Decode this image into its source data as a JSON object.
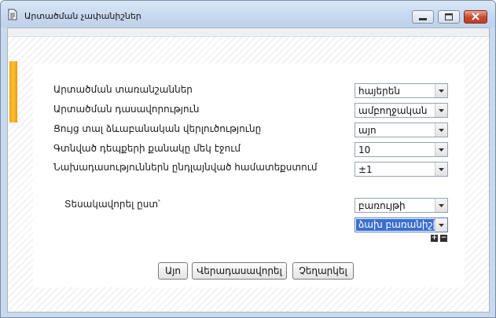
{
  "window": {
    "title": "Արտածման չափանիշներ"
  },
  "form": {
    "rows": [
      {
        "label": "Արտածման տառանշաններ",
        "value": "հայերեն"
      },
      {
        "label": "Արտածման դասավորություն",
        "value": "ամբողջական"
      },
      {
        "label": "Ցույց տալ ձևաբանական վերլուծությունը",
        "value": "այո"
      },
      {
        "label": "Գտնված դեպքերի քանակը մեկ էջում",
        "value": "10"
      },
      {
        "label": "Նախադասություններն ընդլայնված համատեքստում",
        "value": "±1"
      }
    ],
    "sort": {
      "label": "Տեսակավորել ըստ՝",
      "primary": "բառույթի",
      "secondary": "ձախ բառանիշի",
      "add_label": "+",
      "remove_label": "−"
    }
  },
  "buttons": {
    "ok": "Այո",
    "reset": "Վերադասավորել",
    "cancel": "Չեղարկել"
  },
  "colors": {
    "accent": "#3a6fd0",
    "close": "#c8462e",
    "orange_tab": "#f3a20f"
  },
  "icons": [
    "document-icon",
    "minimize-icon",
    "maximize-icon",
    "close-icon",
    "chevron-down-icon"
  ]
}
